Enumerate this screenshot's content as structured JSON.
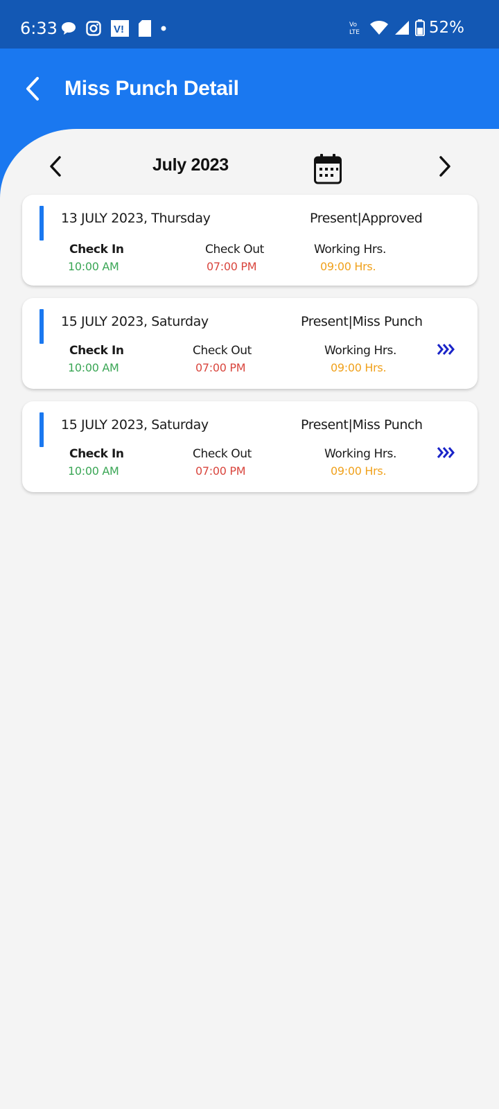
{
  "status_bar": {
    "time": "6:33",
    "battery": "52%",
    "network": "Vo LTE",
    "icons": [
      "chat-icon",
      "instagram-icon",
      "vi-icon",
      "sim-icon",
      "dot-icon",
      "volte-icon",
      "wifi-icon",
      "signal-icon",
      "battery-icon"
    ]
  },
  "header": {
    "title": "Miss Punch Detail",
    "back_icon": "chevron-left-icon",
    "color": "#1a78f0"
  },
  "month_nav": {
    "label": "July 2023",
    "prev_icon": "chevron-left-icon",
    "next_icon": "chevron-right-icon",
    "calendar_icon": "calendar-icon"
  },
  "labels": {
    "check_in": "Check In",
    "check_out": "Check Out",
    "working_hrs": "Working Hrs."
  },
  "records": [
    {
      "date": "13 JULY 2023, Thursday",
      "status": "Present|Approved",
      "check_in": "10:00 AM",
      "check_out": "07:00 PM",
      "working_hrs": "09:00 Hrs.",
      "has_detail": false
    },
    {
      "date": "15 JULY 2023, Saturday",
      "status": "Present|Miss Punch",
      "check_in": "10:00 AM",
      "check_out": "07:00 PM",
      "working_hrs": "09:00 Hrs.",
      "has_detail": true
    },
    {
      "date": "15 JULY 2023, Saturday",
      "status": "Present|Miss Punch",
      "check_in": "10:00 AM",
      "check_out": "07:00 PM",
      "working_hrs": "09:00 Hrs.",
      "has_detail": true
    }
  ],
  "colors": {
    "check_in": "#3aa655",
    "check_out": "#d9463e",
    "working_hrs": "#f0a11c",
    "detail_arrow": "#1a24c8",
    "accent": "#1a78f0"
  }
}
